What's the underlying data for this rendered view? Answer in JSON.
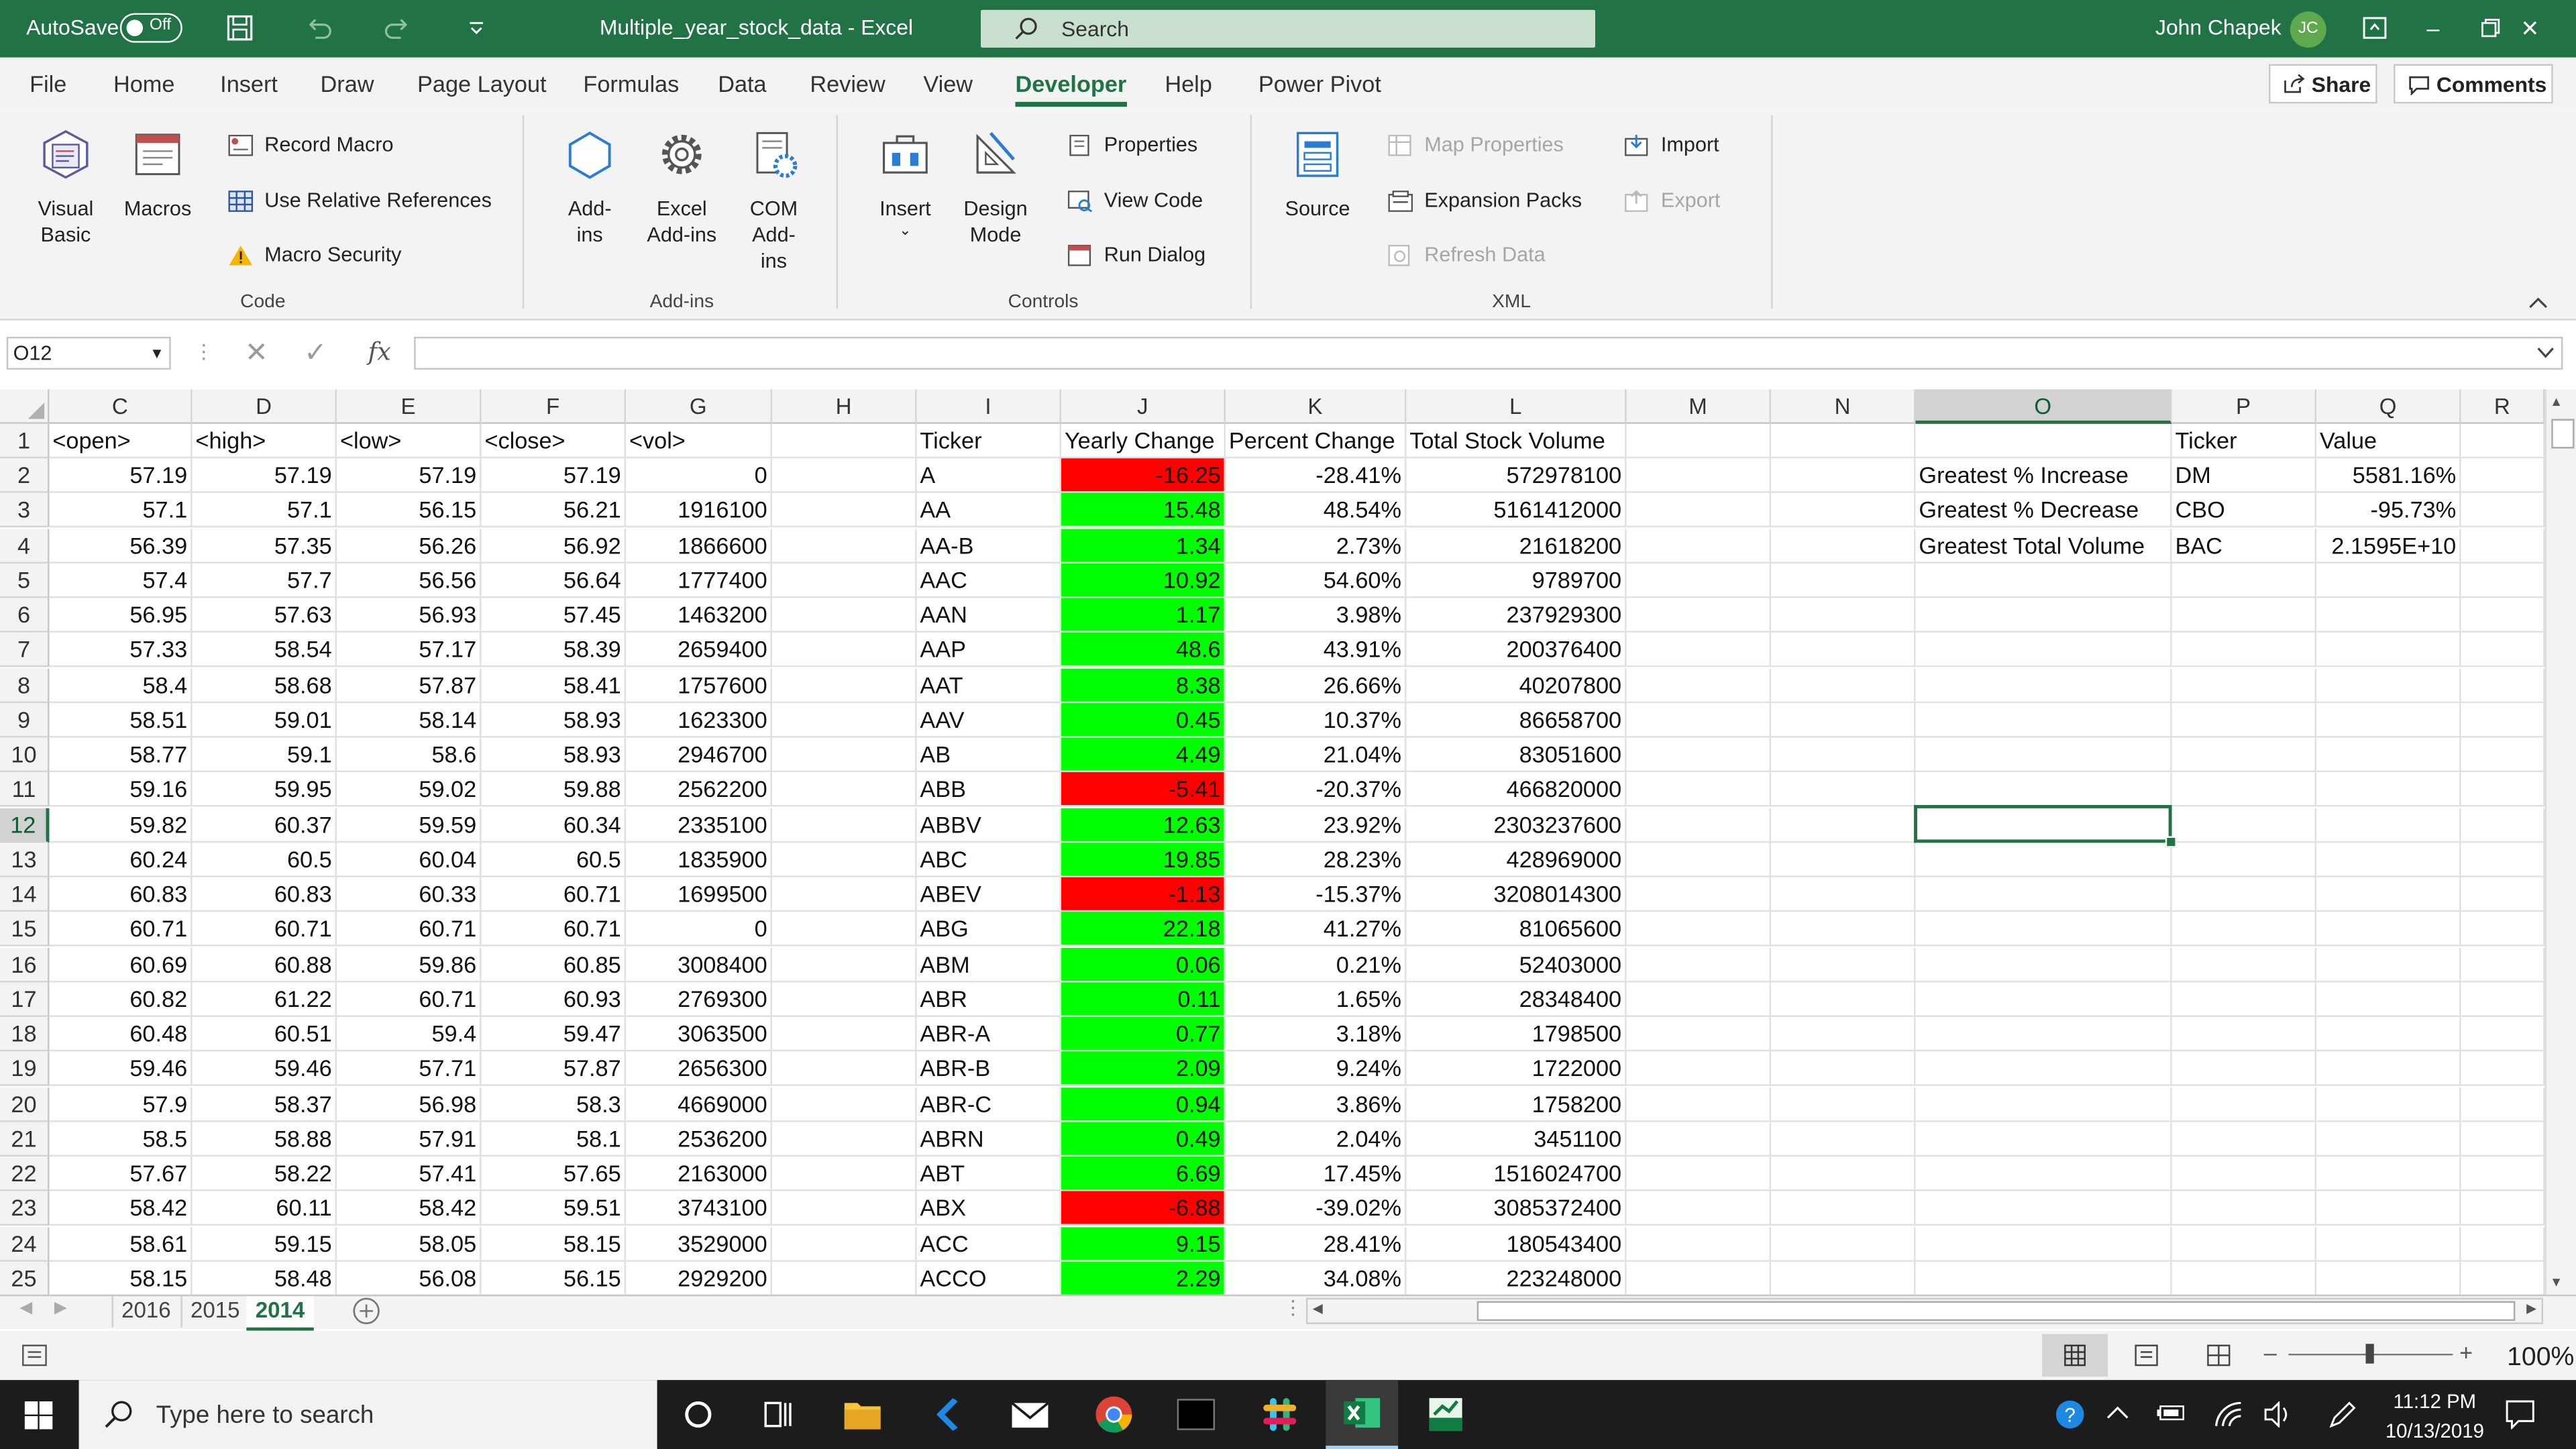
{
  "titlebar": {
    "autosave_label": "AutoSave",
    "autosave_state": "Off",
    "doc_title": "Multiple_year_stock_data  -  Excel",
    "search_placeholder": "Search",
    "user_name": "John Chapek",
    "user_initials": "JC"
  },
  "menu": {
    "tabs": [
      "File",
      "Home",
      "Insert",
      "Draw",
      "Page Layout",
      "Formulas",
      "Data",
      "Review",
      "View",
      "Developer",
      "Help",
      "Power Pivot"
    ],
    "active": "Developer",
    "share_label": "Share",
    "comments_label": "Comments"
  },
  "ribbon": {
    "code": {
      "visual_basic": "Visual Basic",
      "macros": "Macros",
      "record_macro": "Record Macro",
      "relative_refs": "Use Relative References",
      "macro_security": "Macro Security",
      "group_label": "Code"
    },
    "addins": {
      "add_ins": "Add-ins",
      "excel_add_ins": "Excel Add-ins",
      "com_add_ins": "COM Add-ins",
      "group_label": "Add-ins"
    },
    "controls": {
      "insert": "Insert",
      "design_mode": "Design Mode",
      "properties": "Properties",
      "view_code": "View Code",
      "run_dialog": "Run Dialog",
      "group_label": "Controls"
    },
    "xml": {
      "source": "Source",
      "map_properties": "Map Properties",
      "expansion_packs": "Expansion Packs",
      "refresh_data": "Refresh Data",
      "import": "Import",
      "export": "Export",
      "group_label": "XML"
    }
  },
  "formula_bar": {
    "name_box": "O12",
    "fx": "fx",
    "value": ""
  },
  "columns": [
    "C",
    "D",
    "E",
    "F",
    "G",
    "H",
    "I",
    "J",
    "K",
    "L",
    "M",
    "N",
    "O",
    "P",
    "Q",
    "R"
  ],
  "selected_column": "O",
  "selected_row": "12",
  "row_numbers": [
    "1",
    "2",
    "3",
    "4",
    "5",
    "6",
    "7",
    "8",
    "9",
    "10",
    "11",
    "12",
    "13",
    "14",
    "15",
    "16",
    "17",
    "18",
    "19",
    "20",
    "21",
    "22",
    "23",
    "24",
    "25"
  ],
  "headers": {
    "open": "<open>",
    "high": "<high>",
    "low": "<low>",
    "close": "<close>",
    "vol": "<vol>",
    "ticker": "Ticker",
    "yearly_change": "Yearly Change",
    "percent_change": "Percent Change",
    "total_volume": "Total Stock Volume"
  },
  "rows": [
    {
      "open": "57.19",
      "high": "57.19",
      "low": "57.19",
      "close": "57.19",
      "vol": "0",
      "ticker": "A",
      "change": "-16.25",
      "pct": "-28.41%",
      "total": "572978100",
      "color": "red"
    },
    {
      "open": "57.1",
      "high": "57.1",
      "low": "56.15",
      "close": "56.21",
      "vol": "1916100",
      "ticker": "AA",
      "change": "15.48",
      "pct": "48.54%",
      "total": "5161412000",
      "color": "green"
    },
    {
      "open": "56.39",
      "high": "57.35",
      "low": "56.26",
      "close": "56.92",
      "vol": "1866600",
      "ticker": "AA-B",
      "change": "1.34",
      "pct": "2.73%",
      "total": "21618200",
      "color": "green"
    },
    {
      "open": "57.4",
      "high": "57.7",
      "low": "56.56",
      "close": "56.64",
      "vol": "1777400",
      "ticker": "AAC",
      "change": "10.92",
      "pct": "54.60%",
      "total": "9789700",
      "color": "green"
    },
    {
      "open": "56.95",
      "high": "57.63",
      "low": "56.93",
      "close": "57.45",
      "vol": "1463200",
      "ticker": "AAN",
      "change": "1.17",
      "pct": "3.98%",
      "total": "237929300",
      "color": "green"
    },
    {
      "open": "57.33",
      "high": "58.54",
      "low": "57.17",
      "close": "58.39",
      "vol": "2659400",
      "ticker": "AAP",
      "change": "48.6",
      "pct": "43.91%",
      "total": "200376400",
      "color": "green"
    },
    {
      "open": "58.4",
      "high": "58.68",
      "low": "57.87",
      "close": "58.41",
      "vol": "1757600",
      "ticker": "AAT",
      "change": "8.38",
      "pct": "26.66%",
      "total": "40207800",
      "color": "green"
    },
    {
      "open": "58.51",
      "high": "59.01",
      "low": "58.14",
      "close": "58.93",
      "vol": "1623300",
      "ticker": "AAV",
      "change": "0.45",
      "pct": "10.37%",
      "total": "86658700",
      "color": "green"
    },
    {
      "open": "58.77",
      "high": "59.1",
      "low": "58.6",
      "close": "58.93",
      "vol": "2946700",
      "ticker": "AB",
      "change": "4.49",
      "pct": "21.04%",
      "total": "83051600",
      "color": "green"
    },
    {
      "open": "59.16",
      "high": "59.95",
      "low": "59.02",
      "close": "59.88",
      "vol": "2562200",
      "ticker": "ABB",
      "change": "-5.41",
      "pct": "-20.37%",
      "total": "466820000",
      "color": "red"
    },
    {
      "open": "59.82",
      "high": "60.37",
      "low": "59.59",
      "close": "60.34",
      "vol": "2335100",
      "ticker": "ABBV",
      "change": "12.63",
      "pct": "23.92%",
      "total": "2303237600",
      "color": "green"
    },
    {
      "open": "60.24",
      "high": "60.5",
      "low": "60.04",
      "close": "60.5",
      "vol": "1835900",
      "ticker": "ABC",
      "change": "19.85",
      "pct": "28.23%",
      "total": "428969000",
      "color": "green"
    },
    {
      "open": "60.83",
      "high": "60.83",
      "low": "60.33",
      "close": "60.71",
      "vol": "1699500",
      "ticker": "ABEV",
      "change": "-1.13",
      "pct": "-15.37%",
      "total": "3208014300",
      "color": "red"
    },
    {
      "open": "60.71",
      "high": "60.71",
      "low": "60.71",
      "close": "60.71",
      "vol": "0",
      "ticker": "ABG",
      "change": "22.18",
      "pct": "41.27%",
      "total": "81065600",
      "color": "green"
    },
    {
      "open": "60.69",
      "high": "60.88",
      "low": "59.86",
      "close": "60.85",
      "vol": "3008400",
      "ticker": "ABM",
      "change": "0.06",
      "pct": "0.21%",
      "total": "52403000",
      "color": "green"
    },
    {
      "open": "60.82",
      "high": "61.22",
      "low": "60.71",
      "close": "60.93",
      "vol": "2769300",
      "ticker": "ABR",
      "change": "0.11",
      "pct": "1.65%",
      "total": "28348400",
      "color": "green"
    },
    {
      "open": "60.48",
      "high": "60.51",
      "low": "59.4",
      "close": "59.47",
      "vol": "3063500",
      "ticker": "ABR-A",
      "change": "0.77",
      "pct": "3.18%",
      "total": "1798500",
      "color": "green"
    },
    {
      "open": "59.46",
      "high": "59.46",
      "low": "57.71",
      "close": "57.87",
      "vol": "2656300",
      "ticker": "ABR-B",
      "change": "2.09",
      "pct": "9.24%",
      "total": "1722000",
      "color": "green"
    },
    {
      "open": "57.9",
      "high": "58.37",
      "low": "56.98",
      "close": "58.3",
      "vol": "4669000",
      "ticker": "ABR-C",
      "change": "0.94",
      "pct": "3.86%",
      "total": "1758200",
      "color": "green"
    },
    {
      "open": "58.5",
      "high": "58.88",
      "low": "57.91",
      "close": "58.1",
      "vol": "2536200",
      "ticker": "ABRN",
      "change": "0.49",
      "pct": "2.04%",
      "total": "3451100",
      "color": "green"
    },
    {
      "open": "57.67",
      "high": "58.22",
      "low": "57.41",
      "close": "57.65",
      "vol": "2163000",
      "ticker": "ABT",
      "change": "6.69",
      "pct": "17.45%",
      "total": "1516024700",
      "color": "green"
    },
    {
      "open": "58.42",
      "high": "60.11",
      "low": "58.42",
      "close": "59.51",
      "vol": "3743100",
      "ticker": "ABX",
      "change": "-6.88",
      "pct": "-39.02%",
      "total": "3085372400",
      "color": "red"
    },
    {
      "open": "58.61",
      "high": "59.15",
      "low": "58.05",
      "close": "58.15",
      "vol": "3529000",
      "ticker": "ACC",
      "change": "9.15",
      "pct": "28.41%",
      "total": "180543400",
      "color": "green"
    },
    {
      "open": "58.15",
      "high": "58.48",
      "low": "56.08",
      "close": "56.15",
      "vol": "2929200",
      "ticker": "ACCO",
      "change": "2.29",
      "pct": "34.08%",
      "total": "223248000",
      "color": "green"
    }
  ],
  "summary": {
    "ticker_header": "Ticker",
    "value_header": "Value",
    "rows": [
      {
        "label": "Greatest % Increase",
        "ticker": "DM",
        "value": "5581.16%"
      },
      {
        "label": "Greatest % Decrease",
        "ticker": "CBO",
        "value": "-95.73%"
      },
      {
        "label": "Greatest Total Volume",
        "ticker": "BAC",
        "value": "2.1595E+10"
      }
    ]
  },
  "sheet_tabs": [
    "2016",
    "2015",
    "2014"
  ],
  "active_sheet": "2014",
  "status": {
    "zoom": "100%"
  },
  "taskbar": {
    "search_placeholder": "Type here to search",
    "time": "11:12 PM",
    "date": "10/13/2019"
  },
  "colors": {
    "excel_green": "#217346",
    "positive": "#00ff00",
    "negative": "#ff0000"
  }
}
